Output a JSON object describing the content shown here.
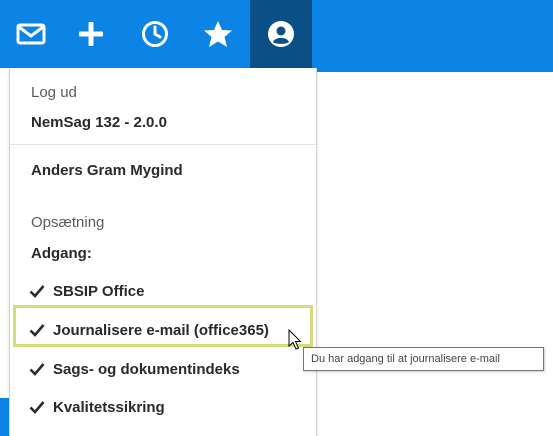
{
  "toolbar": {
    "icons": [
      "mail-icon",
      "plus-icon",
      "clock-icon",
      "star-icon",
      "user-circle-icon"
    ]
  },
  "menu": {
    "logout": "Log ud",
    "version": "NemSag 132 - 2.0.0",
    "user_name": "Anders Gram Mygind",
    "settings": "Opsætning",
    "access_heading": "Adgang:",
    "access_items": [
      "SBSIP Office",
      "Journalisere e-mail (office365)",
      "Sags- og dokumentindeks",
      "Kvalitetssikring"
    ]
  },
  "tooltip": {
    "text": "Du har adgang til at journalisere e-mail"
  },
  "colors": {
    "topbar": "#0b84e6",
    "active_tab": "#0a4f86",
    "highlight_border": "#d6dc7c"
  }
}
